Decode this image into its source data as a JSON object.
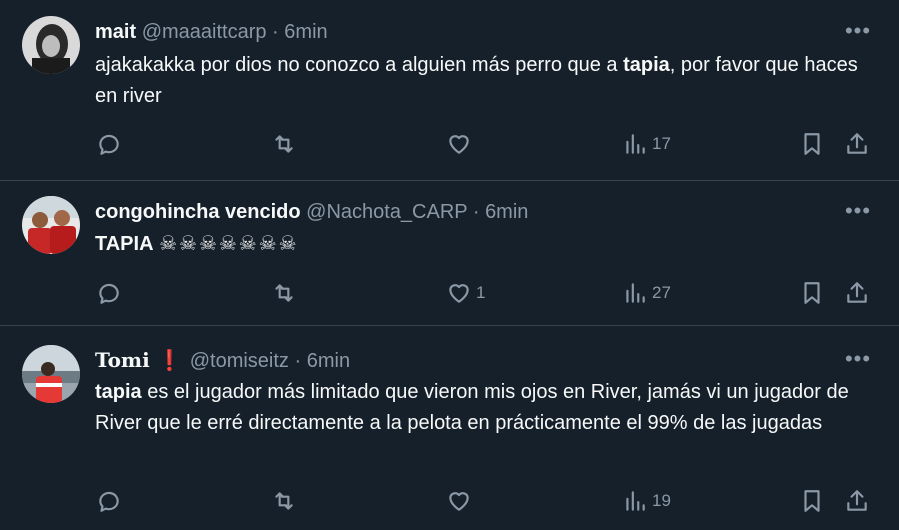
{
  "tweets": [
    {
      "name": "mait",
      "handle": "@maaaittcarp",
      "sep": "·",
      "time": "6min",
      "text_before": "ajakakakka por dios no conozco a alguien más perro que a ",
      "text_bold": "tapia",
      "text_after": ", por favor que haces en river",
      "likes": "",
      "views": "17"
    },
    {
      "name": "congohincha vencido",
      "handle": "@Nachota_CARP",
      "sep": "·",
      "time": "6min",
      "text_bold": "TAPIA",
      "text_emoji": "☠☠☠☠☠☠☠",
      "likes": "1",
      "views": "27"
    },
    {
      "name": "Tomi",
      "badge": "❗",
      "handle": "@tomiseitz",
      "sep": "·",
      "time": "6min",
      "text_bold": "tapia",
      "text_after": " es el jugador más limitado que vieron mis ojos en River, jamás vi un jugador de River que le erré directamente a la pelota en prácticamente el 99% de las jugadas",
      "likes": "",
      "views": "19"
    }
  ],
  "icons": {
    "reply": "reply-icon",
    "retweet": "retweet-icon",
    "like": "heart-icon",
    "views": "views-icon",
    "bookmark": "bookmark-icon",
    "share": "share-icon",
    "more": "more-icon"
  },
  "colors": {
    "background": "#15202b",
    "muted": "#8b98a5",
    "divider": "#38444d",
    "text": "#f7f9f9"
  }
}
